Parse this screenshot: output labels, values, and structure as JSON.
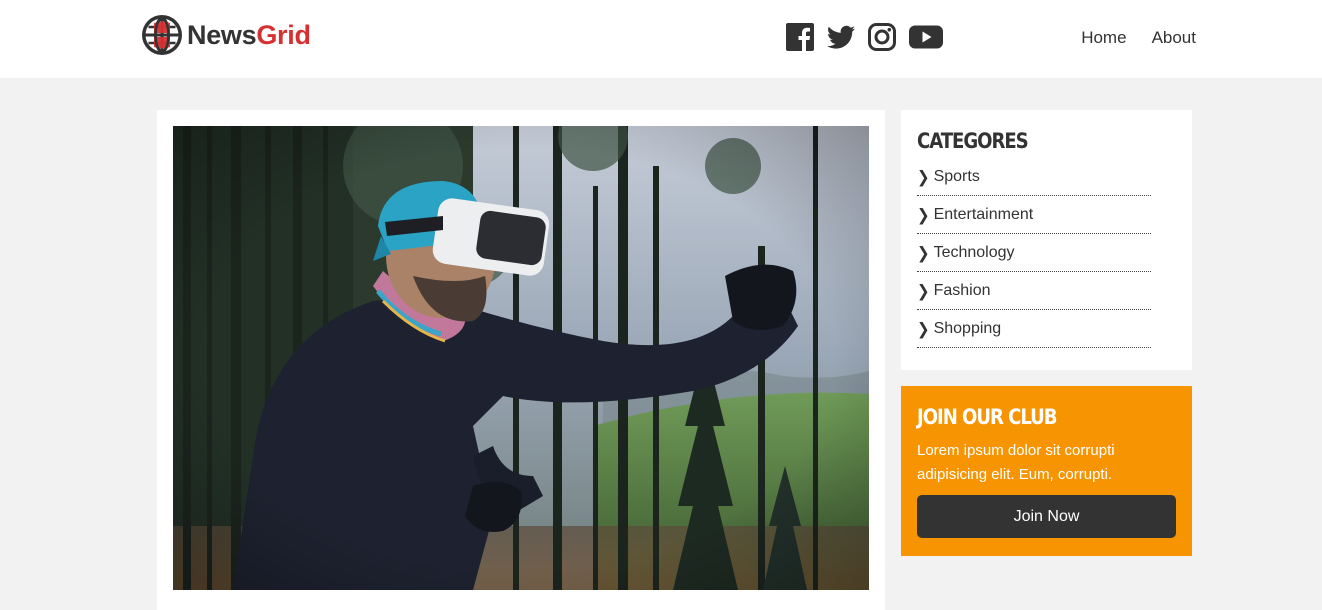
{
  "brand": {
    "name_part1": "News",
    "name_part2": "Grid",
    "logo_icon": "globe-icon",
    "colors": {
      "dark": "#333333",
      "red": "#d63031"
    }
  },
  "social": [
    {
      "name": "facebook",
      "icon": "facebook-icon"
    },
    {
      "name": "twitter",
      "icon": "twitter-icon"
    },
    {
      "name": "instagram",
      "icon": "instagram-icon"
    },
    {
      "name": "youtube",
      "icon": "youtube-icon"
    }
  ],
  "nav": {
    "home": "Home",
    "about": "About"
  },
  "article": {
    "image": "Man wearing a VR headset and blue bandana, throwing a punch in a forest"
  },
  "categories": {
    "title": "Categores",
    "items": [
      "Sports",
      "Entertainment",
      "Technology",
      "Fashion",
      "Shopping"
    ],
    "chevron_icon": "chevron-right-icon"
  },
  "club": {
    "title": "Join Our Club",
    "text": "Lorem ipsum dolor sit corrupti adipisicing elit. Eum, corrupti.",
    "button": "Join Now",
    "color": "#f79401"
  }
}
